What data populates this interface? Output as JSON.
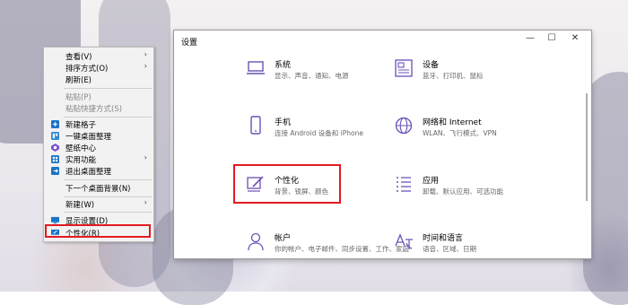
{
  "window": {
    "title": "设置",
    "minimize": "—",
    "maximize": "☐",
    "close": "✕"
  },
  "settings_tiles": [
    {
      "name": "系统",
      "desc": "显示、声音、通知、电源",
      "icon": "laptop-icon"
    },
    {
      "name": "设备",
      "desc": "蓝牙、打印机、鼠标",
      "icon": "keyboard-icon"
    },
    {
      "name": "手机",
      "desc": "连接 Android 设备和 iPhone",
      "icon": "phone-icon"
    },
    {
      "name": "网络和 Internet",
      "desc": "WLAN、飞行模式、VPN",
      "icon": "globe-icon"
    },
    {
      "name": "个性化",
      "desc": "背景、锁屏、颜色",
      "icon": "brush-icon"
    },
    {
      "name": "应用",
      "desc": "卸载、默认应用、可选功能",
      "icon": "apps-list-icon"
    },
    {
      "name": "帐户",
      "desc": "你的帐户、电子邮件、同步设置、工作、家庭",
      "icon": "person-icon"
    },
    {
      "name": "时间和语言",
      "desc": "语音、区域、日期",
      "icon": "language-icon"
    }
  ],
  "context_menu": {
    "items": [
      {
        "label": "查看(V)",
        "submenu": true
      },
      {
        "label": "排序方式(O)",
        "submenu": true
      },
      {
        "label": "刷新(E)"
      },
      {
        "label": "粘贴(P)",
        "disabled": true
      },
      {
        "label": "粘贴快捷方式(S)",
        "disabled": true
      },
      {
        "label": "新建格子"
      },
      {
        "label": "一键桌面整理"
      },
      {
        "label": "壁纸中心"
      },
      {
        "label": "实用功能",
        "submenu": true
      },
      {
        "label": "退出桌面整理"
      },
      {
        "label": "下一个桌面背景(N)"
      },
      {
        "label": "新建(W)",
        "submenu": true
      },
      {
        "label": "显示设置(D)"
      },
      {
        "label": "个性化(R)"
      }
    ],
    "submenu_arrow": "›"
  },
  "colors": {
    "highlight_red": "#e21b23",
    "accent_blue": "#1a73c7",
    "icon_purple": "#6b4fb8"
  }
}
